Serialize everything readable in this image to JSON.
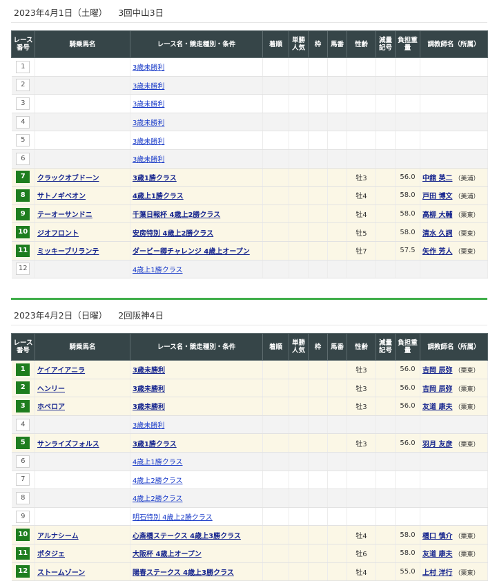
{
  "headers": {
    "race_no": "レース番号",
    "horse": "騎乗馬名",
    "race": "レース名・競走種別・条件",
    "finish": "着順",
    "odds_pop": "単勝人気",
    "frame": "枠",
    "horse_no": "馬番",
    "sex_age": "性齢",
    "reduction": "減量記号",
    "weight": "負担重量",
    "trainer": "調教師名（所属）"
  },
  "days": [
    {
      "date": "2023年4月1日（土曜）",
      "venue": "3回中山3日",
      "rows": [
        {
          "no": "1",
          "ride": false,
          "horse": "",
          "race": "3歳未勝利",
          "sex": "",
          "weight": "",
          "trainer": "",
          "aff": ""
        },
        {
          "no": "2",
          "ride": false,
          "horse": "",
          "race": "3歳未勝利",
          "sex": "",
          "weight": "",
          "trainer": "",
          "aff": ""
        },
        {
          "no": "3",
          "ride": false,
          "horse": "",
          "race": "3歳未勝利",
          "sex": "",
          "weight": "",
          "trainer": "",
          "aff": ""
        },
        {
          "no": "4",
          "ride": false,
          "horse": "",
          "race": "3歳未勝利",
          "sex": "",
          "weight": "",
          "trainer": "",
          "aff": ""
        },
        {
          "no": "5",
          "ride": false,
          "horse": "",
          "race": "3歳未勝利",
          "sex": "",
          "weight": "",
          "trainer": "",
          "aff": ""
        },
        {
          "no": "6",
          "ride": false,
          "horse": "",
          "race": "3歳未勝利",
          "sex": "",
          "weight": "",
          "trainer": "",
          "aff": ""
        },
        {
          "no": "7",
          "ride": true,
          "horse": "クラックオブドーン",
          "race": "3歳1勝クラス",
          "sex": "牡3",
          "weight": "56.0",
          "trainer": "中舘 英二",
          "aff": "（美浦）"
        },
        {
          "no": "8",
          "ride": true,
          "horse": "サトノギベオン",
          "race": "4歳上1勝クラス",
          "sex": "牡4",
          "weight": "58.0",
          "trainer": "戸田 博文",
          "aff": "（美浦）"
        },
        {
          "no": "9",
          "ride": true,
          "horse": "テーオーサンドニ",
          "race": "千葉日報杯 4歳上2勝クラス",
          "sex": "牡4",
          "weight": "58.0",
          "trainer": "高柳 大輔",
          "aff": "（栗東）"
        },
        {
          "no": "10",
          "ride": true,
          "horse": "ジオフロント",
          "race": "安房特別 4歳上2勝クラス",
          "sex": "牡5",
          "weight": "58.0",
          "trainer": "清水 久詞",
          "aff": "（栗東）"
        },
        {
          "no": "11",
          "ride": true,
          "horse": "ミッキーブリランテ",
          "race": "ダービー卿チャレンジ 4歳上オープン",
          "sex": "牡7",
          "weight": "57.5",
          "trainer": "矢作 芳人",
          "aff": "（栗東）"
        },
        {
          "no": "12",
          "ride": false,
          "horse": "",
          "race": "4歳上1勝クラス",
          "sex": "",
          "weight": "",
          "trainer": "",
          "aff": ""
        }
      ]
    },
    {
      "date": "2023年4月2日（日曜）",
      "venue": "2回阪神4日",
      "rows": [
        {
          "no": "1",
          "ride": true,
          "horse": "ケイアイアニラ",
          "race": "3歳未勝利",
          "sex": "牡3",
          "weight": "56.0",
          "trainer": "吉岡 辰弥",
          "aff": "（栗東）"
        },
        {
          "no": "2",
          "ride": true,
          "horse": "ヘンリー",
          "race": "3歳未勝利",
          "sex": "牡3",
          "weight": "56.0",
          "trainer": "吉岡 辰弥",
          "aff": "（栗東）"
        },
        {
          "no": "3",
          "ride": true,
          "horse": "ホベロア",
          "race": "3歳未勝利",
          "sex": "牡3",
          "weight": "56.0",
          "trainer": "友道 康夫",
          "aff": "（栗東）"
        },
        {
          "no": "4",
          "ride": false,
          "horse": "",
          "race": "3歳未勝利",
          "sex": "",
          "weight": "",
          "trainer": "",
          "aff": ""
        },
        {
          "no": "5",
          "ride": true,
          "horse": "サンライズフォルス",
          "race": "3歳1勝クラス",
          "sex": "牡3",
          "weight": "56.0",
          "trainer": "羽月 友彦",
          "aff": "（栗東）"
        },
        {
          "no": "6",
          "ride": false,
          "horse": "",
          "race": "4歳上1勝クラス",
          "sex": "",
          "weight": "",
          "trainer": "",
          "aff": ""
        },
        {
          "no": "7",
          "ride": false,
          "horse": "",
          "race": "4歳上2勝クラス",
          "sex": "",
          "weight": "",
          "trainer": "",
          "aff": ""
        },
        {
          "no": "8",
          "ride": false,
          "horse": "",
          "race": "4歳上2勝クラス",
          "sex": "",
          "weight": "",
          "trainer": "",
          "aff": ""
        },
        {
          "no": "9",
          "ride": false,
          "horse": "",
          "race": "明石特別 4歳上2勝クラス",
          "sex": "",
          "weight": "",
          "trainer": "",
          "aff": ""
        },
        {
          "no": "10",
          "ride": true,
          "horse": "アルナシーム",
          "race": "心斎橋ステークス 4歳上3勝クラス",
          "sex": "牡4",
          "weight": "58.0",
          "trainer": "橋口 慎介",
          "aff": "（栗東）"
        },
        {
          "no": "11",
          "ride": true,
          "horse": "ポタジェ",
          "race": "大阪杯 4歳上オープン",
          "sex": "牡6",
          "weight": "58.0",
          "trainer": "友道 康夫",
          "aff": "（栗東）"
        },
        {
          "no": "12",
          "ride": true,
          "horse": "ストームゾーン",
          "race": "陽春ステークス 4歳上3勝クラス",
          "sex": "牡4",
          "weight": "55.0",
          "trainer": "上村 洋行",
          "aff": "（栗東）"
        }
      ]
    }
  ]
}
